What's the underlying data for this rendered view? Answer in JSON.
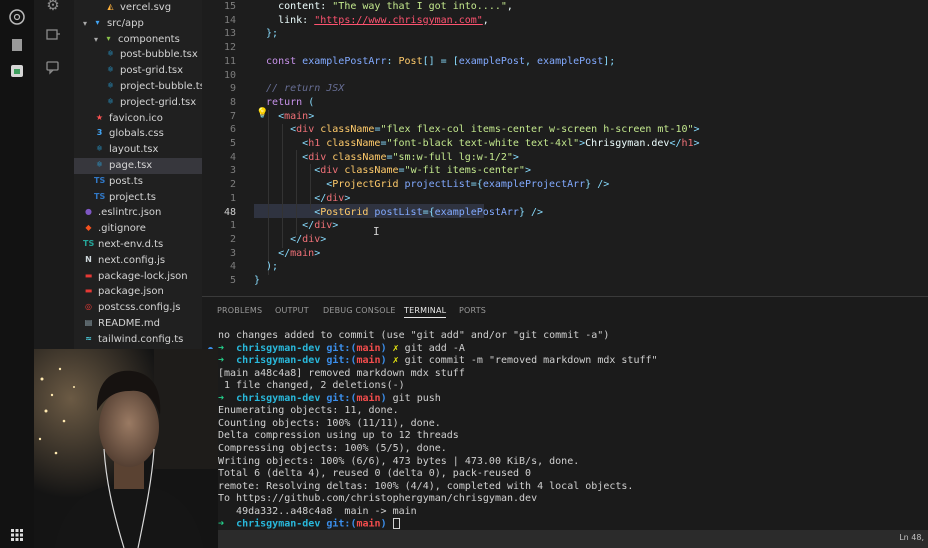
{
  "explorer": {
    "items": [
      {
        "label": "vercel.svg",
        "icon": "svg-file-icon",
        "color": "#ffb13b",
        "glyph": "◭",
        "depth": 3
      },
      {
        "label": "src/app",
        "icon": "folder-open-icon",
        "color": "#42a5f5",
        "glyph": "▾",
        "depth": 1,
        "folder": true
      },
      {
        "label": "components",
        "icon": "folder-open-icon",
        "color": "#8bc34a",
        "glyph": "▾",
        "depth": 2,
        "folder": true
      },
      {
        "label": "post-bubble.tsx",
        "icon": "react-file-icon",
        "color": "#29b6f6",
        "glyph": "⚛",
        "depth": 3
      },
      {
        "label": "post-grid.tsx",
        "icon": "react-file-icon",
        "color": "#29b6f6",
        "glyph": "⚛",
        "depth": 3
      },
      {
        "label": "project-bubble.tsx",
        "icon": "react-file-icon",
        "color": "#29b6f6",
        "glyph": "⚛",
        "depth": 3
      },
      {
        "label": "project-grid.tsx",
        "icon": "react-file-icon",
        "color": "#29b6f6",
        "glyph": "⚛",
        "depth": 3
      },
      {
        "label": "favicon.ico",
        "icon": "favicon-file-icon",
        "color": "#ff5252",
        "glyph": "★",
        "depth": 2
      },
      {
        "label": "globals.css",
        "icon": "css-file-icon",
        "color": "#42a5f5",
        "glyph": "3",
        "depth": 2
      },
      {
        "label": "layout.tsx",
        "icon": "react-file-icon",
        "color": "#29b6f6",
        "glyph": "⚛",
        "depth": 2
      },
      {
        "label": "page.tsx",
        "icon": "react-file-icon",
        "color": "#29b6f6",
        "glyph": "⚛",
        "depth": 2,
        "active": true
      },
      {
        "label": "post.ts",
        "icon": "typescript-file-icon",
        "color": "#3178c6",
        "glyph": "TS",
        "depth": 2
      },
      {
        "label": "project.ts",
        "icon": "typescript-file-icon",
        "color": "#3178c6",
        "glyph": "TS",
        "depth": 2
      },
      {
        "label": ".eslintrc.json",
        "icon": "eslint-file-icon",
        "color": "#7e57c2",
        "glyph": "●",
        "depth": 1
      },
      {
        "label": ".gitignore",
        "icon": "git-file-icon",
        "color": "#f4511e",
        "glyph": "◆",
        "depth": 1
      },
      {
        "label": "next-env.d.ts",
        "icon": "typescript-def-file-icon",
        "color": "#26a69a",
        "glyph": "TS",
        "depth": 1
      },
      {
        "label": "next.config.js",
        "icon": "next-file-icon",
        "color": "#cfd8dc",
        "glyph": "N",
        "depth": 1
      },
      {
        "label": "package-lock.json",
        "icon": "npm-file-icon",
        "color": "#e53935",
        "glyph": "▬",
        "depth": 1
      },
      {
        "label": "package.json",
        "icon": "npm-file-icon",
        "color": "#e53935",
        "glyph": "▬",
        "depth": 1
      },
      {
        "label": "postcss.config.js",
        "icon": "postcss-file-icon",
        "color": "#e53935",
        "glyph": "◎",
        "depth": 1
      },
      {
        "label": "README.md",
        "icon": "markdown-file-icon",
        "color": "#90a4ae",
        "glyph": "▤",
        "depth": 1
      },
      {
        "label": "tailwind.config.ts",
        "icon": "tailwind-file-icon",
        "color": "#4dd0e1",
        "glyph": "≈",
        "depth": 1
      }
    ]
  },
  "editor": {
    "lines": [
      {
        "n": "15",
        "parts": [
          [
            "txt",
            "    content: "
          ],
          [
            "str",
            "\"The way that I got into....\""
          ],
          [
            "txt",
            ","
          ]
        ]
      },
      {
        "n": "14",
        "parts": [
          [
            "txt",
            "    link: "
          ],
          [
            "url",
            "\"https://www.chrisgyman.com\""
          ],
          [
            "txt",
            ","
          ]
        ]
      },
      {
        "n": "13",
        "parts": [
          [
            "pun",
            "  };"
          ]
        ]
      },
      {
        "n": "12",
        "parts": []
      },
      {
        "n": "11",
        "parts": [
          [
            "kw",
            "  const "
          ],
          [
            "ty",
            "examplePostArr"
          ],
          [
            "pun",
            ": "
          ],
          [
            "attr",
            "Post"
          ],
          [
            "pun",
            "[] = ["
          ],
          [
            "ty",
            "examplePost"
          ],
          [
            "pun",
            ", "
          ],
          [
            "ty",
            "examplePost"
          ],
          [
            "pun",
            "];"
          ]
        ]
      },
      {
        "n": "10",
        "parts": []
      },
      {
        "n": "9",
        "parts": [
          [
            "com",
            "  // return JSX"
          ]
        ]
      },
      {
        "n": "8",
        "parts": [
          [
            "kw",
            "  return "
          ],
          [
            "pun",
            "("
          ]
        ]
      },
      {
        "n": "7",
        "parts": [
          [
            "pun",
            "    <"
          ],
          [
            "tag",
            "main"
          ],
          [
            "pun",
            ">"
          ]
        ]
      },
      {
        "n": "6",
        "parts": [
          [
            "pun",
            "      <"
          ],
          [
            "tag",
            "div "
          ],
          [
            "attr",
            "className"
          ],
          [
            "pun",
            "="
          ],
          [
            "str",
            "\"flex flex-col items-center w-screen h-screen mt-10\""
          ],
          [
            "pun",
            ">"
          ]
        ]
      },
      {
        "n": "5",
        "parts": [
          [
            "pun",
            "        <"
          ],
          [
            "tag",
            "h1 "
          ],
          [
            "attr",
            "className"
          ],
          [
            "pun",
            "="
          ],
          [
            "str",
            "\"font-black text-white text-4xl\""
          ],
          [
            "pun",
            ">"
          ],
          [
            "txt",
            "Chrisgyman.dev"
          ],
          [
            "pun",
            "</"
          ],
          [
            "tag",
            "h1"
          ],
          [
            "pun",
            ">"
          ]
        ]
      },
      {
        "n": "4",
        "parts": [
          [
            "pun",
            "        <"
          ],
          [
            "tag",
            "div "
          ],
          [
            "attr",
            "className"
          ],
          [
            "pun",
            "="
          ],
          [
            "str",
            "\"sm:w-full lg:w-1/2\""
          ],
          [
            "pun",
            ">"
          ]
        ]
      },
      {
        "n": "3",
        "parts": [
          [
            "pun",
            "          <"
          ],
          [
            "tag",
            "div "
          ],
          [
            "attr",
            "className"
          ],
          [
            "pun",
            "="
          ],
          [
            "str",
            "\"w-fit items-center\""
          ],
          [
            "pun",
            ">"
          ]
        ]
      },
      {
        "n": "2",
        "parts": [
          [
            "pun",
            "            <"
          ],
          [
            "attr",
            "ProjectGrid "
          ],
          [
            "ty",
            "projectList"
          ],
          [
            "pun",
            "={"
          ],
          [
            "ty",
            "exampleProjectArr"
          ],
          [
            "pun",
            "} />"
          ]
        ]
      },
      {
        "n": "1",
        "parts": [
          [
            "pun",
            "          </"
          ],
          [
            "tag",
            "div"
          ],
          [
            "pun",
            ">"
          ]
        ]
      },
      {
        "n": "48",
        "cur": true,
        "parts": [
          [
            "pun",
            "          <"
          ],
          [
            "attr",
            "PostGrid "
          ],
          [
            "ty",
            "postList"
          ],
          [
            "pun",
            "={"
          ],
          [
            "ty",
            "examplePostArr"
          ],
          [
            "pun",
            "} />"
          ]
        ]
      },
      {
        "n": "1",
        "parts": [
          [
            "pun",
            "        </"
          ],
          [
            "tag",
            "div"
          ],
          [
            "pun",
            ">"
          ]
        ]
      },
      {
        "n": "2",
        "parts": [
          [
            "pun",
            "      </"
          ],
          [
            "tag",
            "div"
          ],
          [
            "pun",
            ">"
          ]
        ]
      },
      {
        "n": "3",
        "parts": [
          [
            "pun",
            "    </"
          ],
          [
            "tag",
            "main"
          ],
          [
            "pun",
            ">"
          ]
        ]
      },
      {
        "n": "4",
        "parts": [
          [
            "pun",
            "  );"
          ]
        ]
      },
      {
        "n": "5",
        "parts": [
          [
            "pun",
            "}"
          ]
        ]
      }
    ]
  },
  "panel": {
    "tabs": [
      "PROBLEMS",
      "OUTPUT",
      "DEBUG CONSOLE",
      "TERMINAL",
      "PORTS"
    ],
    "active_tab": "TERMINAL",
    "terminal": [
      {
        "type": "out",
        "text": "no changes added to commit (use \"git add\" and/or \"git commit -a\")"
      },
      {
        "type": "prompt",
        "user": "chrisgyman-dev",
        "git": "git:(",
        "branch": "main",
        "close": ")",
        "dirty": "✗",
        "cmd": " git add -A",
        "dot": true
      },
      {
        "type": "prompt",
        "user": "chrisgyman-dev",
        "git": "git:(",
        "branch": "main",
        "close": ")",
        "dirty": "✗",
        "cmd": " git commit -m \"removed markdown mdx stuff\"",
        "dot": true
      },
      {
        "type": "out",
        "text": "[main a48c4a8] removed markdown mdx stuff"
      },
      {
        "type": "out",
        "text": " 1 file changed, 2 deletions(-)"
      },
      {
        "type": "prompt",
        "user": "chrisgyman-dev",
        "git": "git:(",
        "branch": "main",
        "close": ")",
        "dirty": "",
        "cmd": " git push",
        "dot": true
      },
      {
        "type": "out",
        "text": "Enumerating objects: 11, done."
      },
      {
        "type": "out",
        "text": "Counting objects: 100% (11/11), done."
      },
      {
        "type": "out",
        "text": "Delta compression using up to 12 threads"
      },
      {
        "type": "out",
        "text": "Compressing objects: 100% (5/5), done."
      },
      {
        "type": "out",
        "text": "Writing objects: 100% (6/6), 473 bytes | 473.00 KiB/s, done."
      },
      {
        "type": "out",
        "text": "Total 6 (delta 4), reused 0 (delta 0), pack-reused 0"
      },
      {
        "type": "out",
        "text": "remote: Resolving deltas: 100% (4/4), completed with 4 local objects."
      },
      {
        "type": "out",
        "text": "To https://github.com/christophergyman/chrisgyman.dev"
      },
      {
        "type": "out",
        "text": "   49da332..a48c4a8  main -> main"
      },
      {
        "type": "prompt",
        "user": "chrisgyman-dev",
        "git": "git:(",
        "branch": "main",
        "close": ")",
        "dirty": "",
        "cmd": " ",
        "dot": false,
        "cursor": true
      }
    ]
  },
  "status": {
    "position": "Ln 48,"
  },
  "colors": {
    "editor_bg": "#1d1d1d",
    "panel_bg": "#1b1b1b",
    "accent": "#3b8eea"
  }
}
